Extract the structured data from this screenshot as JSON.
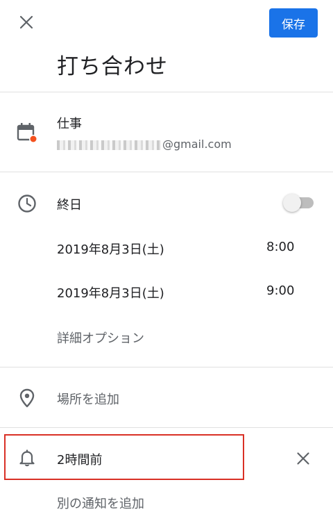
{
  "header": {
    "close_icon": "close-icon",
    "save_label": "保存",
    "title": "打ち合わせ"
  },
  "calendar": {
    "icon": "calendar-icon",
    "name": "仕事",
    "email_visible": "@gmail.com",
    "accent_color": "#f4511e"
  },
  "time": {
    "icon": "clock-icon",
    "all_day_label": "終日",
    "all_day_on": false,
    "start_date": "2019年8月3日(土)",
    "start_time": "8:00",
    "end_date": "2019年8月3日(土)",
    "end_time": "9:00",
    "more_options": "詳細オプション"
  },
  "location": {
    "icon": "location-pin-icon",
    "placeholder": "場所を追加"
  },
  "notification": {
    "icon": "bell-icon",
    "value": "2時間前",
    "remove_icon": "close-icon",
    "add_label": "別の通知を追加"
  },
  "colors": {
    "primary": "#1a73e8",
    "highlight": "#d93025"
  }
}
